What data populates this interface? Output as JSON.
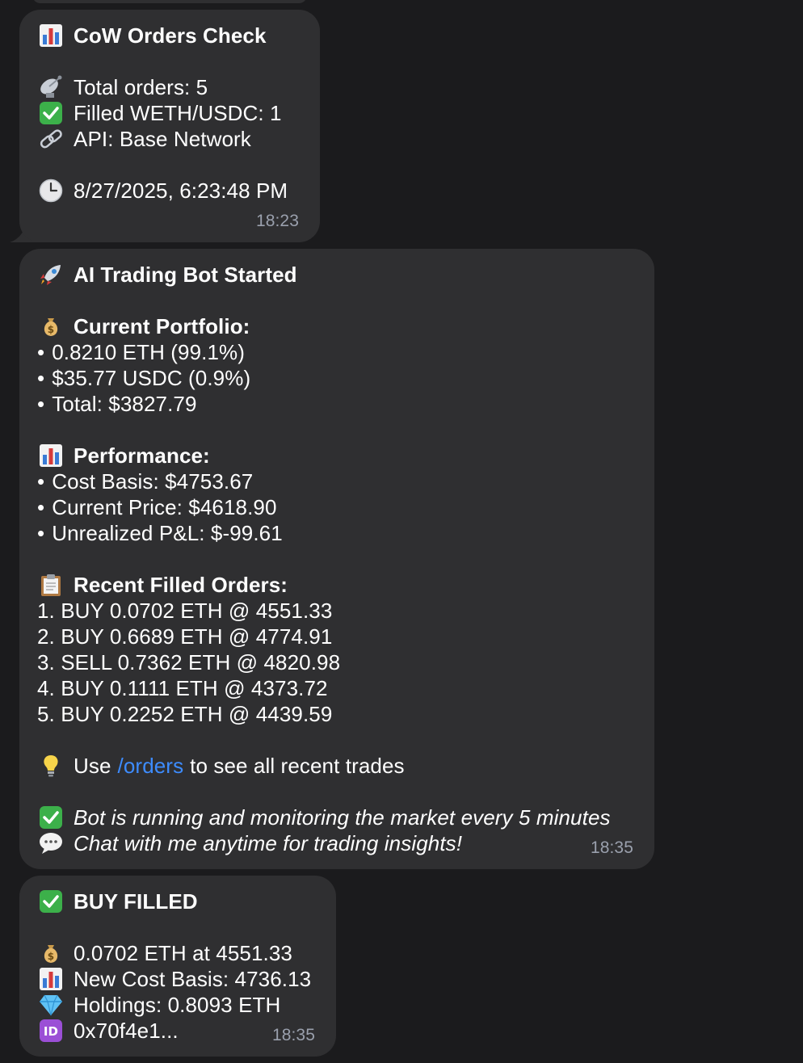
{
  "colors": {
    "background": "#1b1b1d",
    "bubble": "#2f2f31",
    "link": "#3d8cff",
    "timestamp": "#9aa0ad"
  },
  "messages": [
    {
      "title": "CoW Orders Check",
      "total_orders": "Total orders: 5",
      "filled": "Filled WETH/USDC: 1",
      "api": "API: Base Network",
      "datetime": "8/27/2025, 6:23:48 PM",
      "time": "18:23"
    },
    {
      "title": "AI Trading Bot Started",
      "portfolio_header": "Current Portfolio:",
      "portfolio": [
        "0.8210 ETH (99.1%)",
        "$35.77 USDC (0.9%)",
        "Total: $3827.79"
      ],
      "performance_header": "Performance:",
      "performance": [
        "Cost Basis: $4753.67",
        "Current Price: $4618.90",
        "Unrealized P&L: $-99.61"
      ],
      "orders_header": "Recent Filled Orders:",
      "orders": [
        "1. BUY 0.0702 ETH @ 4551.33",
        "2. BUY 0.6689 ETH @ 4774.91",
        "3. SELL 0.7362 ETH @ 4820.98",
        "4. BUY 0.1111 ETH @ 4373.72",
        "5. BUY 0.2252 ETH @ 4439.59"
      ],
      "tip_prefix": "Use",
      "tip_link": "/orders",
      "tip_suffix": "to see all recent trades",
      "status": "Bot is running and monitoring the market every 5 minutes",
      "chat": "Chat with me anytime for trading insights!",
      "time": "18:35"
    },
    {
      "title": "BUY FILLED",
      "amount": "0.0702 ETH at 4551.33",
      "cost_basis": "New Cost Basis: 4736.13",
      "holdings": "Holdings: 0.8093 ETH",
      "id": "0x70f4e1...",
      "id_badge": "ID",
      "time": "18:35"
    }
  ],
  "icons": [
    "bar-chart-icon",
    "satellite-dish-icon",
    "check-mark-icon",
    "link-icon",
    "clock-icon",
    "rocket-icon",
    "money-bag-icon",
    "clipboard-icon",
    "light-bulb-icon",
    "speech-bubble-icon",
    "gem-icon",
    "id-badge-icon"
  ]
}
